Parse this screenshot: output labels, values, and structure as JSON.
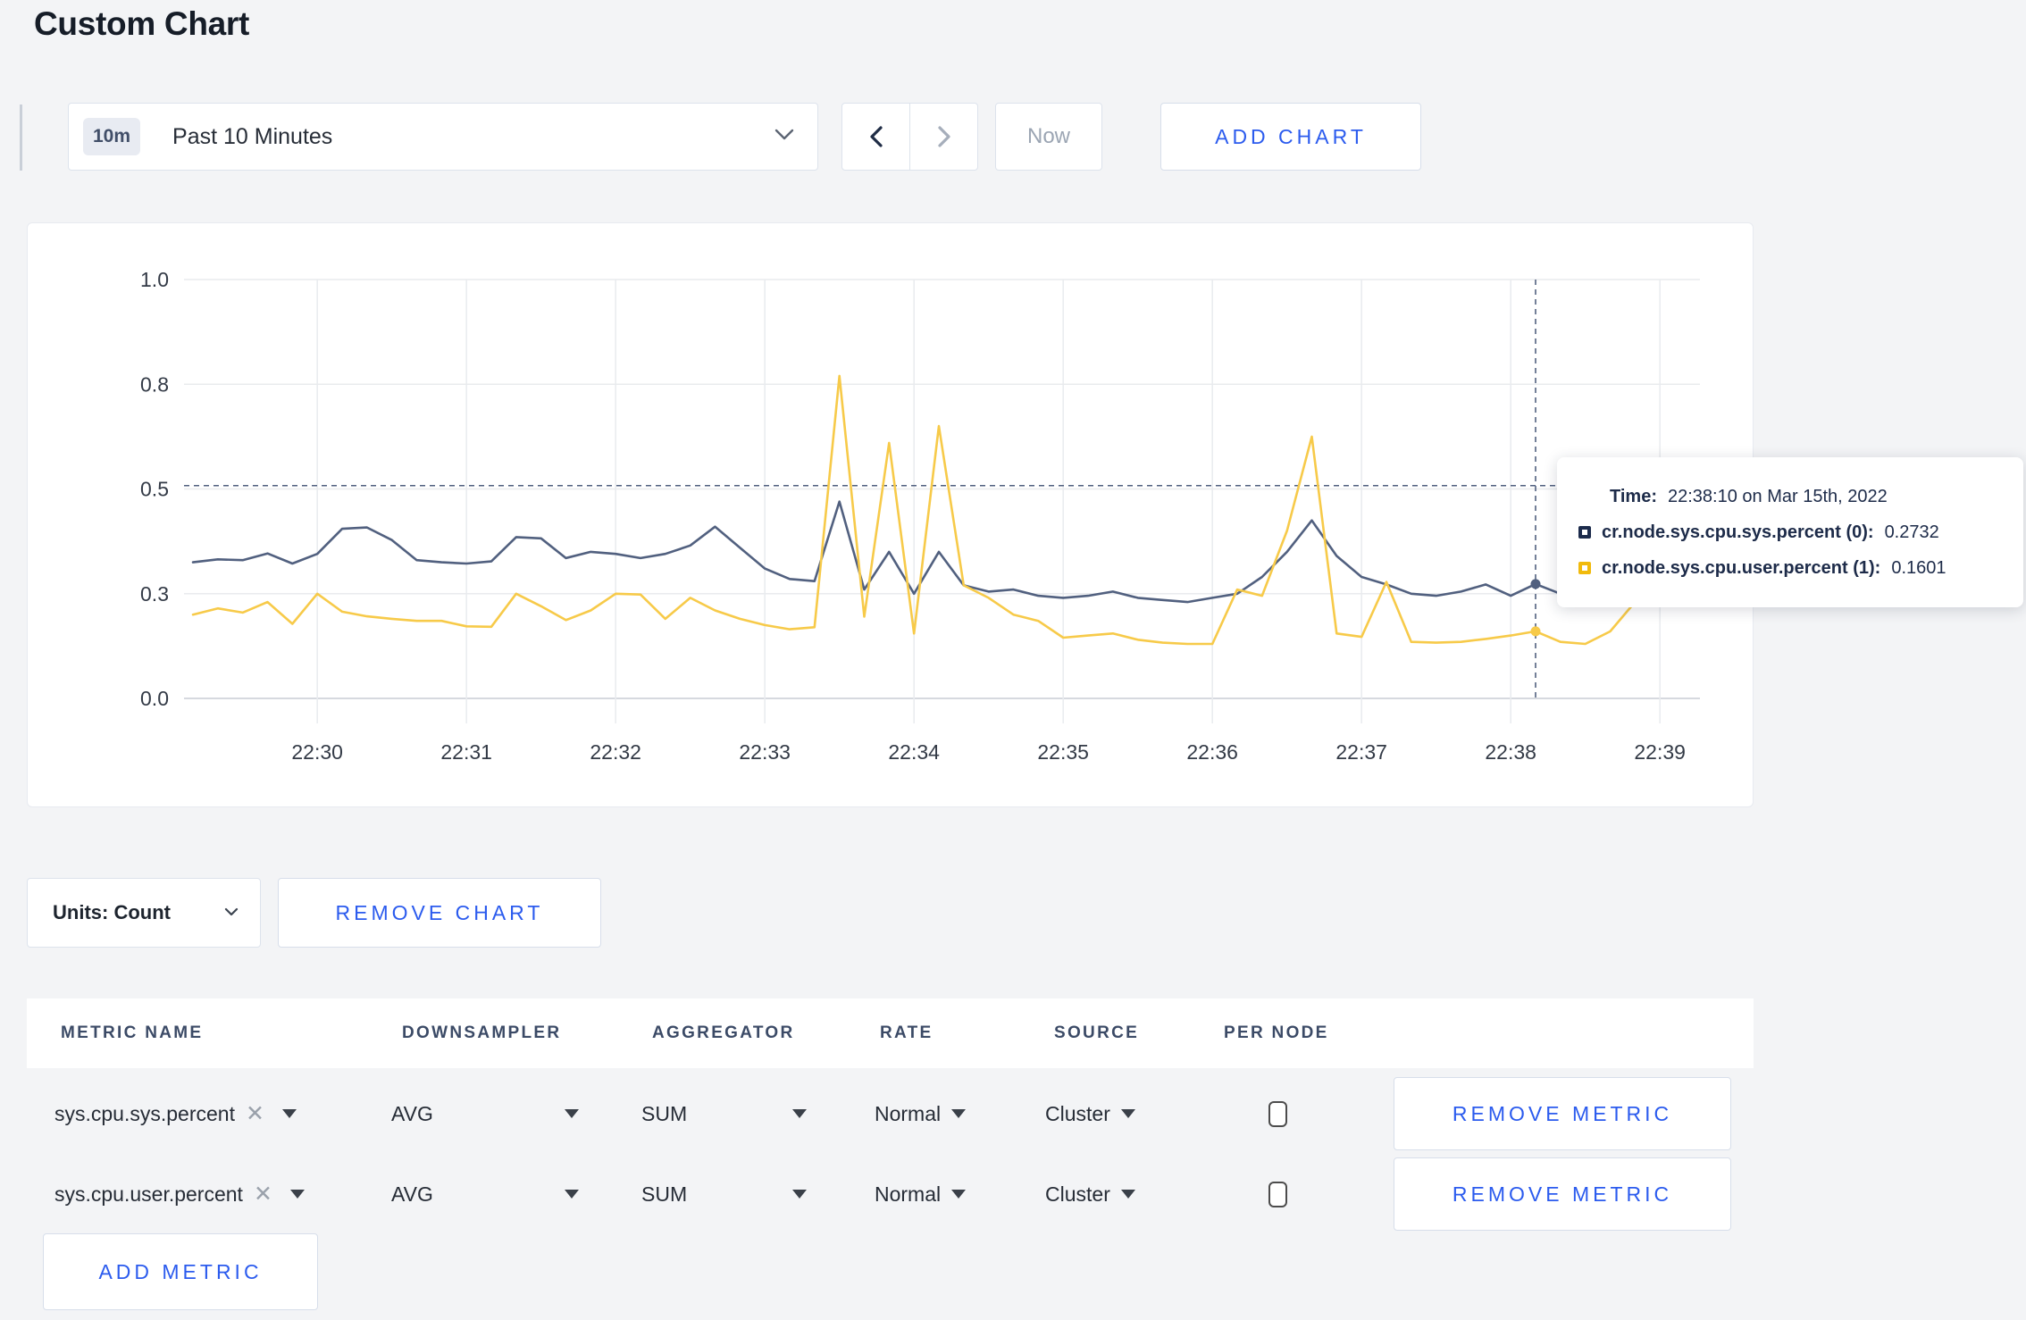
{
  "page": {
    "title": "Custom Chart",
    "accent_blue": "#2b5bee"
  },
  "toolbar": {
    "range_badge": "10m",
    "range_label": "Past 10 Minutes",
    "now_label": "Now",
    "add_chart_label": "ADD CHART"
  },
  "chart_data": {
    "type": "line",
    "title": "",
    "xlabel": "",
    "ylabel": "",
    "ylim": [
      0,
      1
    ],
    "grid": true,
    "legend_position": "none",
    "y_ticks": [
      {
        "v": 0,
        "label": "0.0"
      },
      {
        "v": 0.25,
        "label": "0.3"
      },
      {
        "v": 0.5,
        "label": "0.5"
      },
      {
        "v": 0.75,
        "label": "0.8"
      },
      {
        "v": 1,
        "label": "1.0"
      }
    ],
    "x_tick_labels": [
      "22:30",
      "22:31",
      "22:32",
      "22:33",
      "22:34",
      "22:35",
      "22:36",
      "22:37",
      "22:38",
      "22:39"
    ],
    "x_times": [
      "22:29:10",
      "22:29:20",
      "22:29:30",
      "22:29:40",
      "22:29:50",
      "22:30:00",
      "22:30:10",
      "22:30:20",
      "22:30:30",
      "22:30:40",
      "22:30:50",
      "22:31:00",
      "22:31:10",
      "22:31:20",
      "22:31:30",
      "22:31:40",
      "22:31:50",
      "22:32:00",
      "22:32:10",
      "22:32:20",
      "22:32:30",
      "22:32:40",
      "22:32:50",
      "22:33:00",
      "22:33:10",
      "22:33:20",
      "22:33:30",
      "22:33:40",
      "22:33:50",
      "22:34:00",
      "22:34:10",
      "22:34:20",
      "22:34:30",
      "22:34:40",
      "22:34:50",
      "22:35:00",
      "22:35:10",
      "22:35:20",
      "22:35:30",
      "22:35:40",
      "22:35:50",
      "22:36:00",
      "22:36:10",
      "22:36:20",
      "22:36:30",
      "22:36:40",
      "22:36:50",
      "22:37:00",
      "22:37:10",
      "22:37:20",
      "22:37:30",
      "22:37:40",
      "22:37:50",
      "22:38:00",
      "22:38:10",
      "22:38:20",
      "22:38:30",
      "22:38:40",
      "22:38:50",
      "22:39:00",
      "22:39:10"
    ],
    "series": [
      {
        "name": "cr.node.sys.cpu.sys.percent (0)",
        "color": "#51607f",
        "values": [
          0.325,
          0.332,
          0.33,
          0.346,
          0.322,
          0.345,
          0.405,
          0.408,
          0.378,
          0.33,
          0.325,
          0.322,
          0.327,
          0.385,
          0.382,
          0.335,
          0.35,
          0.345,
          0.335,
          0.345,
          0.365,
          0.41,
          0.36,
          0.31,
          0.285,
          0.28,
          0.47,
          0.26,
          0.35,
          0.25,
          0.35,
          0.27,
          0.255,
          0.26,
          0.245,
          0.24,
          0.245,
          0.255,
          0.24,
          0.235,
          0.23,
          0.24,
          0.25,
          0.29,
          0.35,
          0.425,
          0.34,
          0.29,
          0.272,
          0.25,
          0.245,
          0.255,
          0.272,
          0.245,
          0.2732,
          0.25,
          0.27,
          0.29,
          0.275,
          0.265,
          0.29
        ]
      },
      {
        "name": "cr.node.sys.cpu.user.percent (1)",
        "color": "#f7ca49",
        "values": [
          0.2,
          0.215,
          0.205,
          0.23,
          0.178,
          0.25,
          0.207,
          0.196,
          0.19,
          0.185,
          0.185,
          0.172,
          0.171,
          0.25,
          0.22,
          0.187,
          0.21,
          0.25,
          0.248,
          0.19,
          0.24,
          0.21,
          0.19,
          0.175,
          0.165,
          0.17,
          0.77,
          0.195,
          0.61,
          0.155,
          0.65,
          0.27,
          0.24,
          0.2,
          0.185,
          0.145,
          0.15,
          0.155,
          0.14,
          0.133,
          0.13,
          0.13,
          0.26,
          0.245,
          0.4,
          0.625,
          0.155,
          0.147,
          0.278,
          0.135,
          0.133,
          0.135,
          0.142,
          0.15,
          0.1601,
          0.135,
          0.13,
          0.16,
          0.23,
          0.29,
          0.24
        ]
      }
    ],
    "crosshair": {
      "time": "22:38:10",
      "time_index": 54,
      "hline_value": 0.508
    }
  },
  "tooltip": {
    "time_label": "Time:",
    "time_value": "22:38:10 on Mar 15th, 2022",
    "series": [
      {
        "swatch_color": "#1c2b4c",
        "name": "cr.node.sys.cpu.sys.percent (0):",
        "value": "0.2732"
      },
      {
        "swatch_color": "#f1ba0c",
        "name": "cr.node.sys.cpu.user.percent (1):",
        "value": "0.1601"
      }
    ]
  },
  "chart_controls": {
    "units_label": "Units: Count",
    "remove_chart_label": "REMOVE CHART"
  },
  "metrics_table": {
    "headers": [
      "METRIC NAME",
      "DOWNSAMPLER",
      "AGGREGATOR",
      "RATE",
      "SOURCE",
      "PER NODE"
    ],
    "rows": [
      {
        "metric": "sys.cpu.sys.percent",
        "downsampler": "AVG",
        "aggregator": "SUM",
        "rate": "Normal",
        "source": "Cluster",
        "per_node_checked": false,
        "remove_label": "REMOVE METRIC"
      },
      {
        "metric": "sys.cpu.user.percent",
        "downsampler": "AVG",
        "aggregator": "SUM",
        "rate": "Normal",
        "source": "Cluster",
        "per_node_checked": false,
        "remove_label": "REMOVE METRIC"
      }
    ],
    "add_metric_label": "ADD METRIC"
  }
}
